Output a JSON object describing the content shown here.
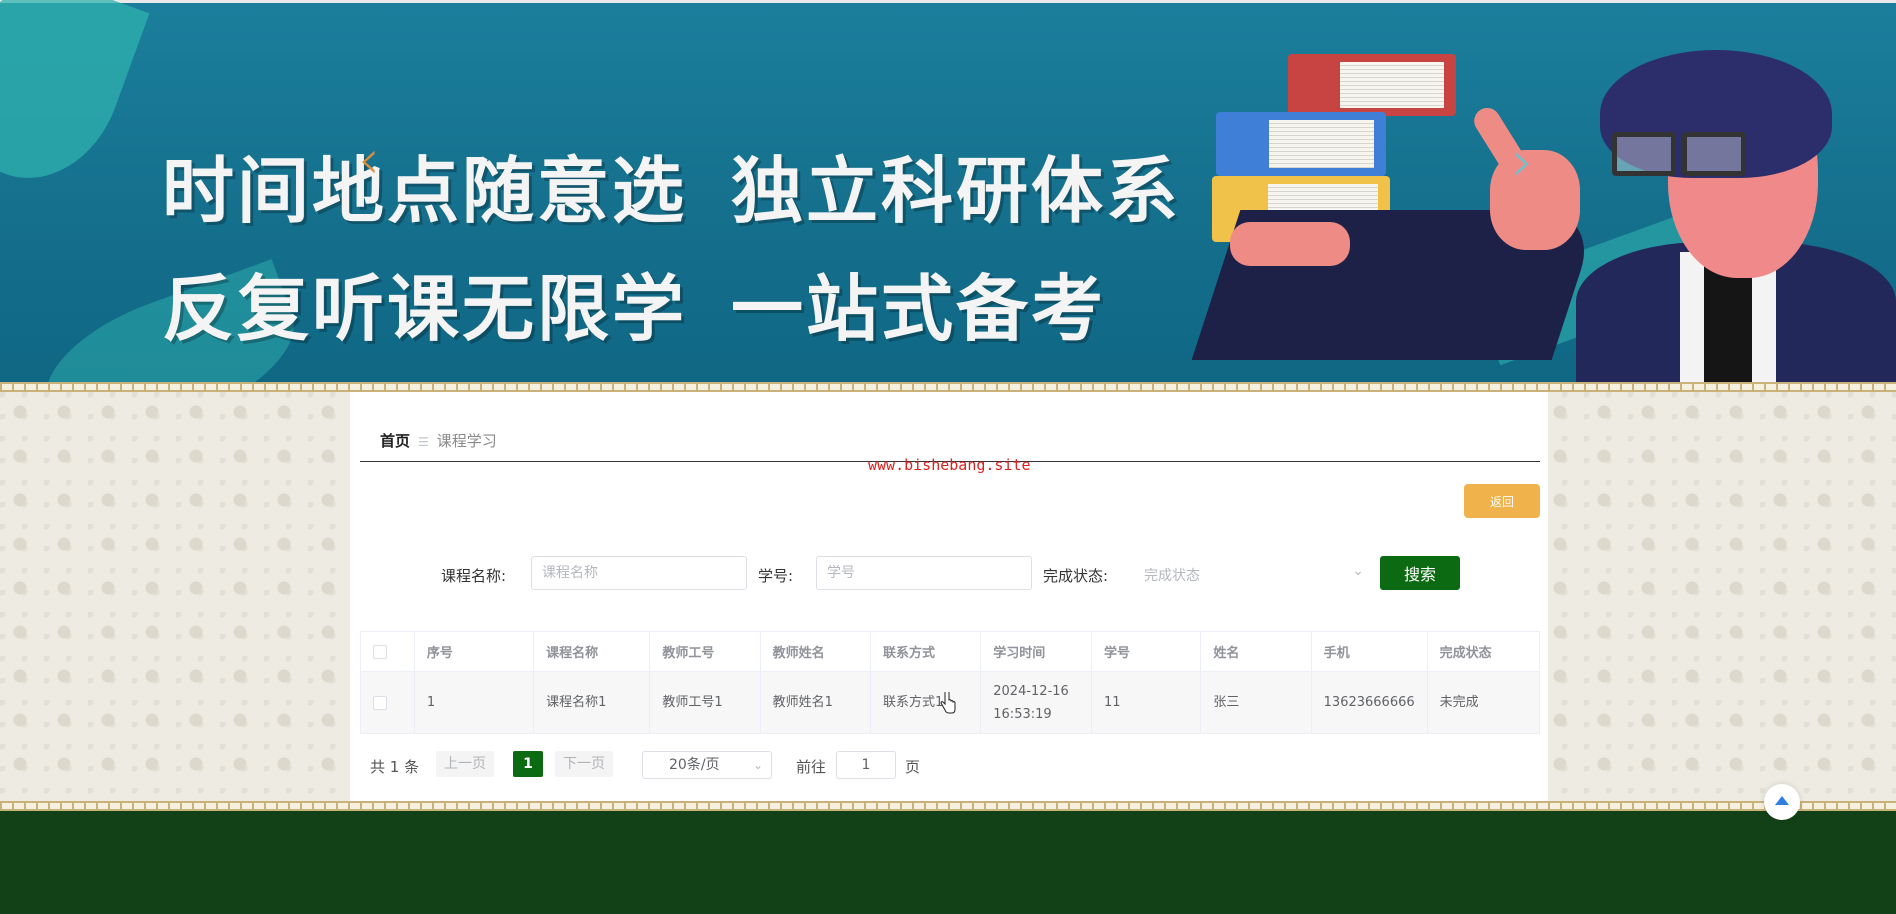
{
  "banner": {
    "line1_a": "时间地点随意选",
    "line1_b": "独立科研体系",
    "line2_a": "反复听课无限学",
    "line2_b": "一站式备考",
    "prev_arrow": "‹",
    "next_arrow": "›"
  },
  "breadcrumb": {
    "home": "首页",
    "separator": "☰",
    "current": "课程学习"
  },
  "watermark": "www.bishebang.site",
  "back_button": "返回",
  "search": {
    "course_label": "课程名称:",
    "course_placeholder": "课程名称",
    "course_value": "",
    "student_label": "学号:",
    "student_placeholder": "学号",
    "student_value": "",
    "status_label": "完成状态:",
    "status_placeholder": "完成状态",
    "button": "搜索"
  },
  "table": {
    "headers": [
      "序号",
      "课程名称",
      "教师工号",
      "教师姓名",
      "联系方式",
      "学习时间",
      "学号",
      "姓名",
      "手机",
      "完成状态"
    ],
    "rows": [
      [
        "1",
        "课程名称1",
        "教师工号1",
        "教师姓名1",
        "联系方式1",
        "2024-12-16 16:53:19",
        "11",
        "张三",
        "13623666666",
        "未完成"
      ]
    ]
  },
  "pagination": {
    "total": "共 1 条",
    "prev": "上一页",
    "current_page": "1",
    "next": "下一页",
    "page_size": "20条/页",
    "goto_label": "前往",
    "goto_value": "1",
    "page_unit": "页"
  },
  "colors": {
    "primary_green": "#0c6a12",
    "footer_green": "#124117",
    "back_button": "#f0b24a",
    "banner_blue": "#15708d",
    "watermark_red": "#e02020"
  },
  "icons": [
    "chevron-left-icon",
    "chevron-right-icon",
    "separator-icon",
    "chevron-down-icon",
    "arrow-up-icon",
    "pointer-cursor-icon"
  ]
}
